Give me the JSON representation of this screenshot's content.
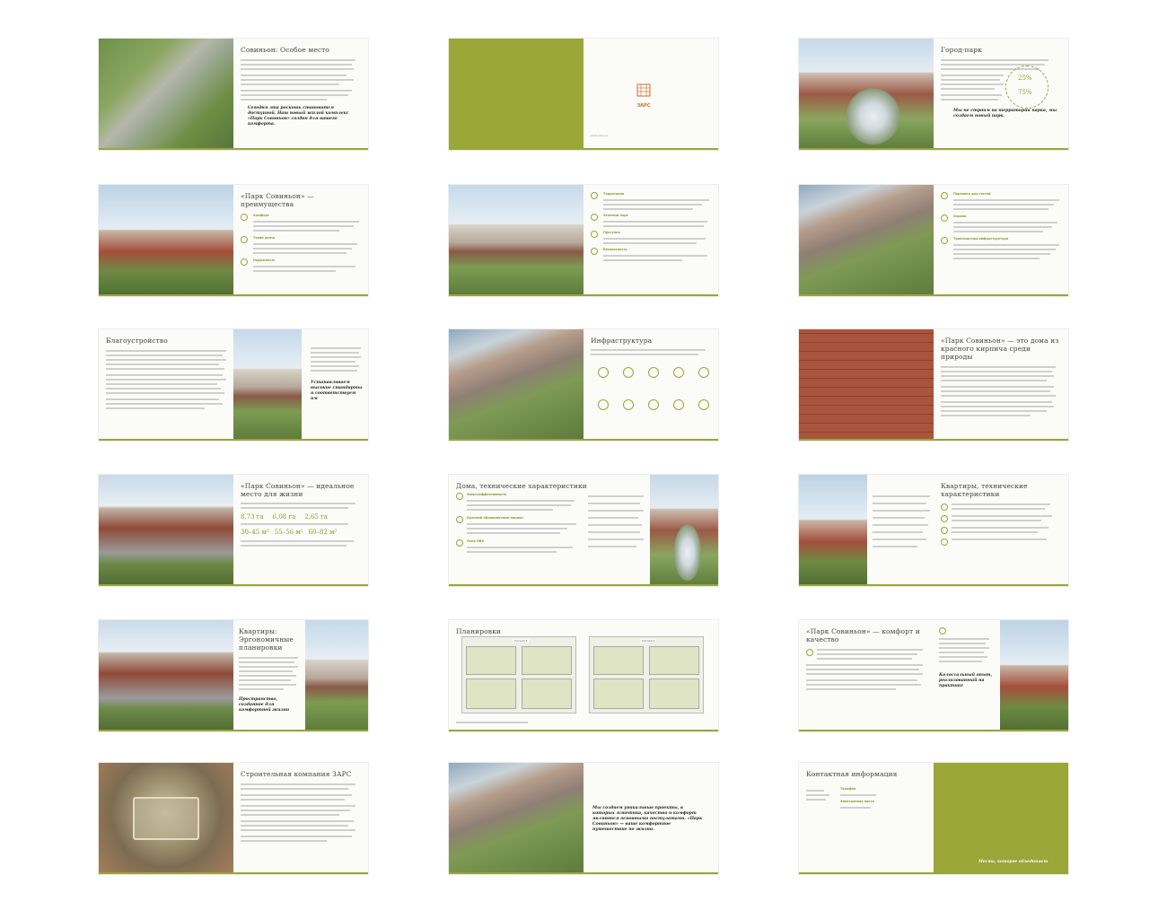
{
  "spreads": [
    {
      "title": "Совиньон: Особое место",
      "quote": "Сегодня эта роскошь становится доступной. Наш новый жилой комплекс «Парк Совиньон» создан для вашего комфорта."
    },
    {
      "logo_text": "ЗАРС",
      "footer": "www.zars.ua"
    },
    {
      "title": "Город-парк",
      "stat1": "25%",
      "stat2": "75%",
      "quote": "Мы не строим на территории парка, мы создаем новый парк."
    },
    {
      "title": "«Парк Совиньон» — преимущества",
      "labels": [
        "Комфорт",
        "Тихий центр",
        "Надежность"
      ]
    },
    {
      "labels": [
        "Территория",
        "Зеленый парк",
        "Прогулки",
        "Безопасность"
      ]
    },
    {
      "labels": [
        "Парковка для гостей",
        "Охрана",
        "Транспортная инфраструктура"
      ]
    },
    {
      "title": "Благоустройство",
      "quote": "Устанавливаем высокие стандарты и соответствуем им"
    },
    {
      "title": "Инфраструктура"
    },
    {
      "title": "«Парк Совиньон» — это дома из красного кирпича среди природы"
    },
    {
      "title": "«Парк Совиньон» — идеальное место для жизни",
      "stats": [
        "8,73 га",
        "6,08 га",
        "2,65 га",
        "30–45 м²",
        "55–56 м²",
        "60–82 м²"
      ]
    },
    {
      "title": "Дома, технические характеристики",
      "labels": [
        "Энергоэффективность",
        "Красный облицовочный кирпич",
        "Окна ПВХ"
      ]
    },
    {
      "title": "Квартиры, технические характеристики"
    },
    {
      "title": "Квартиры: Эргономичные планировки",
      "quote": "Пространство, созданное для комфортной жизни"
    },
    {
      "title": "Планировки",
      "plan_labels": [
        "Секция 1",
        "Секция 2"
      ]
    },
    {
      "title": "«Парк Совиньон» — комфорт и качество",
      "quote": "Колоссальный опыт, реализованный на практике"
    },
    {
      "title": "Строительная компания ЗАРС"
    },
    {
      "quote": "Мы создаем уникальные проекты, в которых эстетика, качество и комфорт являются основными постулатами. «Парк Совиньон» — ваше комфортное путешествие по жизни."
    },
    {
      "title": "Контактная информация",
      "labels": [
        "Телефон",
        "Электронная почта"
      ],
      "slogan": "Место, которое объединяет"
    }
  ],
  "colors": {
    "accent": "#9aa637",
    "accent_text": "#8d9a2c"
  }
}
